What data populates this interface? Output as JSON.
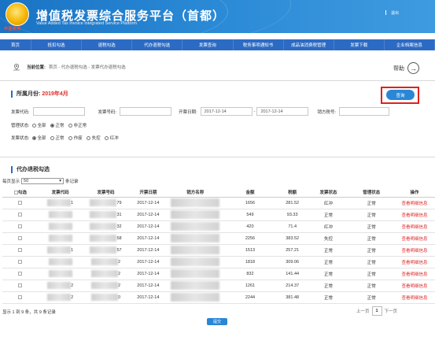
{
  "header": {
    "title": "增值税发票综合服务平台",
    "title_suffix": "（首都）",
    "subtitle": "Value Added Tax Invoice Integrated Service Platform",
    "logo_text": "中国税务",
    "user_label": "",
    "logout": "退出"
  },
  "nav": [
    "首页",
    "抵扣勾选",
    "退税勾选",
    "代办退税勾选",
    "发票查询",
    "税务事项通知书",
    "成品油消费税管理",
    "发票下载",
    "企业档案信息"
  ],
  "breadcrumb": {
    "label": "当前位置:",
    "path": "首页 - 代办退税勾选 - 发票代办退税勾选"
  },
  "help": {
    "label": "帮助"
  },
  "filter": {
    "heading": "所属月份:",
    "month": "2019年4月",
    "query_button": "查询",
    "invoice_code_label": "发票代码:",
    "invoice_code_value": "",
    "invoice_no_label": "发票号码:",
    "invoice_no_value": "",
    "date_label": "开票日期:",
    "date_from": "2017-12-14",
    "date_sep": "-",
    "date_to": "2017-12-14",
    "seller_tax_label": "销方税号:",
    "seller_tax_value": "",
    "mgmt_status_label": "管理状态:",
    "mgmt_options": [
      "全部",
      "正常",
      "非正常"
    ],
    "mgmt_selected": 1,
    "inv_status_label": "发票状态:",
    "inv_options": [
      "全部",
      "正常",
      "作废",
      "失控",
      "红冲"
    ],
    "inv_selected": 0
  },
  "list": {
    "heading": "代办退税勾选",
    "page_size_prefix": "每页显示",
    "page_size": "50",
    "page_size_suffix": "条记录",
    "columns": [
      "勾选",
      "发票代码",
      "发票号码",
      "开票日期",
      "销方名称",
      "金额",
      "税额",
      "发票状态",
      "管理状态",
      "操作"
    ],
    "rows": [
      {
        "code_tail": "1",
        "no_tail": "79",
        "date": "2017-12-14",
        "amount": "1656",
        "tax": "281.52",
        "status": "红冲",
        "mgmt": "正常",
        "op": "查看明细信息"
      },
      {
        "code_tail": "",
        "no_tail": "31",
        "date": "2017-12-14",
        "amount": "549",
        "tax": "93.33",
        "status": "正常",
        "mgmt": "正常",
        "op": "查看明细信息"
      },
      {
        "code_tail": "",
        "no_tail": "32",
        "date": "2017-12-14",
        "amount": "420",
        "tax": "71.4",
        "status": "红冲",
        "mgmt": "正常",
        "op": "查看明细信息"
      },
      {
        "code_tail": "",
        "no_tail": "58",
        "date": "2017-12-14",
        "amount": "2256",
        "tax": "383.52",
        "status": "失控",
        "mgmt": "正常",
        "op": "查看明细信息"
      },
      {
        "code_tail": "1",
        "no_tail": "57",
        "date": "2017-12-14",
        "amount": "1513",
        "tax": "257.21",
        "status": "正常",
        "mgmt": "正常",
        "op": "查看明细信息"
      },
      {
        "code_tail": "",
        "no_tail": "2",
        "date": "2017-12-14",
        "amount": "1818",
        "tax": "309.06",
        "status": "正常",
        "mgmt": "正常",
        "op": "查看明细信息"
      },
      {
        "code_tail": "",
        "no_tail": "2",
        "date": "2017-12-14",
        "amount": "832",
        "tax": "141.44",
        "status": "正常",
        "mgmt": "正常",
        "op": "查看明细信息"
      },
      {
        "code_tail": "2",
        "no_tail": "2",
        "date": "2017-12-14",
        "amount": "1261",
        "tax": "214.37",
        "status": "正常",
        "mgmt": "正常",
        "op": "查看明细信息"
      },
      {
        "code_tail": "2",
        "no_tail": "0",
        "date": "2017-12-14",
        "amount": "2244",
        "tax": "381.48",
        "status": "正常",
        "mgmt": "正常",
        "op": "查看明细信息"
      }
    ],
    "summary": "显示 1 到 9 条，共 9 条记录",
    "pager": {
      "prev": "上一页",
      "current": "1",
      "next": "下一页"
    },
    "submit": "提交"
  }
}
